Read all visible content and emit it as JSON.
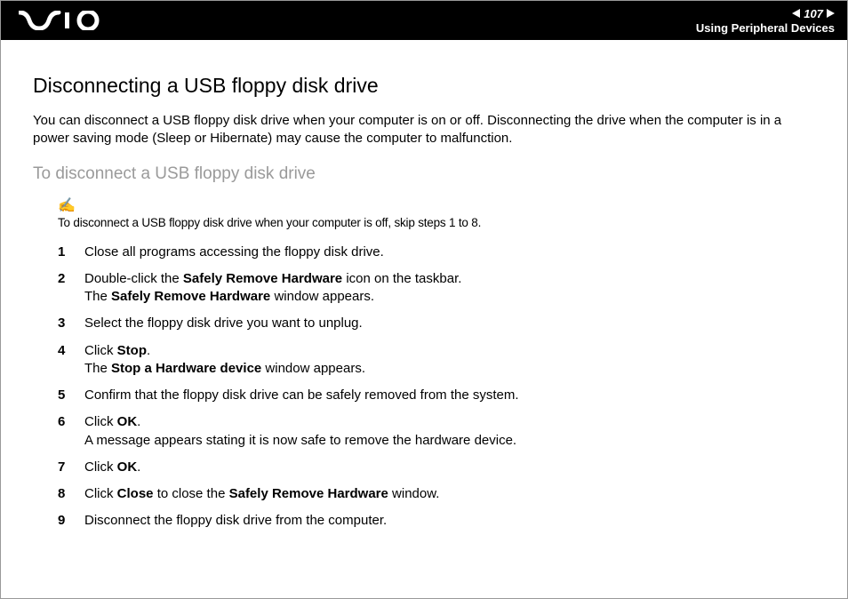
{
  "header": {
    "page_number": "107",
    "section": "Using Peripheral Devices"
  },
  "title": "Disconnecting a USB floppy disk drive",
  "intro": "You can disconnect a USB floppy disk drive when your computer is on or off. Disconnecting the drive when the computer is in a power saving mode (Sleep or Hibernate) may cause the computer to malfunction.",
  "subtitle": "To disconnect a USB floppy disk drive",
  "note_icon": "✍",
  "note": "To disconnect a USB floppy disk drive when your computer is off, skip steps 1 to 8.",
  "steps": [
    {
      "n": "1",
      "parts": [
        {
          "t": "Close all programs accessing the floppy disk drive."
        }
      ]
    },
    {
      "n": "2",
      "parts": [
        {
          "t": "Double-click the "
        },
        {
          "t": "Safely Remove Hardware",
          "b": true
        },
        {
          "t": " icon on the taskbar."
        },
        {
          "br": true
        },
        {
          "t": "The "
        },
        {
          "t": "Safely Remove Hardware",
          "b": true
        },
        {
          "t": " window appears."
        }
      ]
    },
    {
      "n": "3",
      "parts": [
        {
          "t": "Select the floppy disk drive you want to unplug."
        }
      ]
    },
    {
      "n": "4",
      "parts": [
        {
          "t": "Click "
        },
        {
          "t": "Stop",
          "b": true
        },
        {
          "t": "."
        },
        {
          "br": true
        },
        {
          "t": "The "
        },
        {
          "t": "Stop a Hardware device",
          "b": true
        },
        {
          "t": " window appears."
        }
      ]
    },
    {
      "n": "5",
      "parts": [
        {
          "t": "Confirm that the floppy disk drive can be safely removed from the system."
        }
      ]
    },
    {
      "n": "6",
      "parts": [
        {
          "t": "Click "
        },
        {
          "t": "OK",
          "b": true
        },
        {
          "t": "."
        },
        {
          "br": true
        },
        {
          "t": "A message appears stating it is now safe to remove the hardware device."
        }
      ]
    },
    {
      "n": "7",
      "parts": [
        {
          "t": "Click "
        },
        {
          "t": "OK",
          "b": true
        },
        {
          "t": "."
        }
      ]
    },
    {
      "n": "8",
      "parts": [
        {
          "t": "Click "
        },
        {
          "t": "Close",
          "b": true
        },
        {
          "t": " to close the "
        },
        {
          "t": "Safely Remove Hardware",
          "b": true
        },
        {
          "t": " window."
        }
      ]
    },
    {
      "n": "9",
      "parts": [
        {
          "t": "Disconnect the floppy disk drive from the computer."
        }
      ]
    }
  ]
}
